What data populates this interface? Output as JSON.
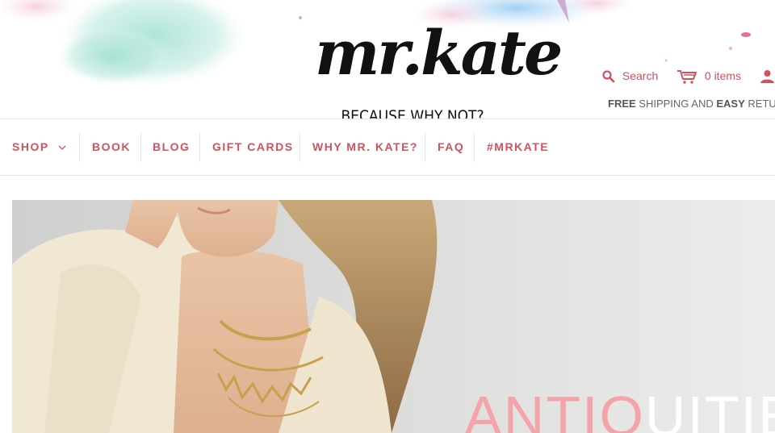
{
  "brand": {
    "logo_text": "mr.kate",
    "tagline": "BECAUSE WHY NOT?"
  },
  "utility": {
    "search_label": "Search",
    "cart_label": "0 items",
    "icons": [
      "search-icon",
      "cart-icon",
      "account-icon"
    ]
  },
  "promo": {
    "word1": "FREE",
    "text1": " SHIPPING AND ",
    "word2": "EASY",
    "text2": " RETU"
  },
  "nav": {
    "shop": "SHOP",
    "book": "BOOK",
    "blog": "BLOG",
    "gift_cards": "GIFT CARDS",
    "why": "WHY MR. KATE?",
    "faq": "FAQ",
    "mrkate": "#MRKATE"
  },
  "hero": {
    "title_part1": "ANTIQ",
    "title_part2": "UITIES"
  },
  "colors": {
    "accent": "#d0525c",
    "hero_pink": "#f4a3a8",
    "rule": "#e4e4e4"
  }
}
